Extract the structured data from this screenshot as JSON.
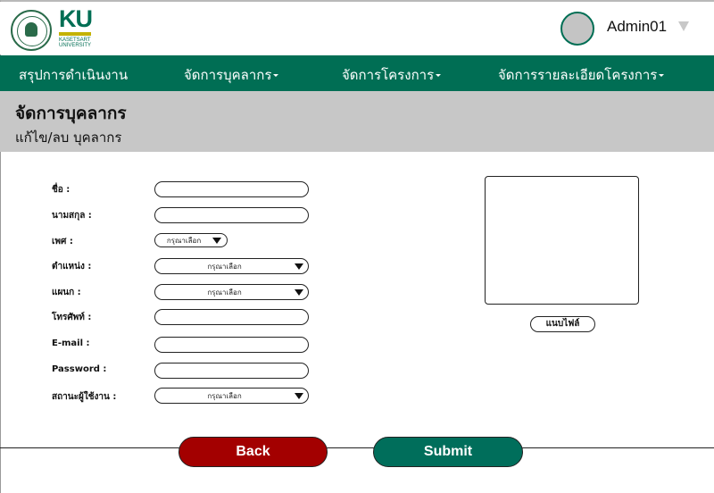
{
  "header": {
    "logo_letters": "KU",
    "logo_text_line1": "KASETSART",
    "logo_text_line2": "UNIVERSITY",
    "user_name": "Admin01"
  },
  "nav": {
    "items": [
      {
        "label": "สรุปการดำเนินงาน",
        "has_dropdown": false
      },
      {
        "label": "จัดการบุคลากร",
        "has_dropdown": true
      },
      {
        "label": "จัดการโครงการ",
        "has_dropdown": true
      },
      {
        "label": "จัดการรายละเอียดโครงการ",
        "has_dropdown": true
      }
    ]
  },
  "page": {
    "title": "จัดการบุคลากร",
    "subtitle": "แก้ไข/ลบ บุคลากร"
  },
  "form": {
    "first_name_label": "ชื่อ :",
    "first_name_value": "",
    "last_name_label": "นามสกุล :",
    "last_name_value": "",
    "gender_label": "เพศ :",
    "gender_selected": "กรุณาเลือก",
    "position_label": "ตำแหน่ง :",
    "position_selected": "กรุณาเลือก",
    "department_label": "แผนก :",
    "department_selected": "กรุณาเลือก",
    "phone_label": "โทรศัพท์ :",
    "phone_value": "",
    "email_label": "E-mail :",
    "email_value": "",
    "password_label": "Password :",
    "password_value": "",
    "status_label": "สถานะผู้ใช้งาน :",
    "status_selected": "กรุณาเลือก",
    "attach_label": "แนบไฟล์"
  },
  "actions": {
    "back_label": "Back",
    "submit_label": "Submit"
  },
  "colors": {
    "brand_green": "#006e54",
    "back_red": "#a30000",
    "title_band_gray": "#c7c7c7",
    "avatar_gray": "#c4c4c4"
  }
}
